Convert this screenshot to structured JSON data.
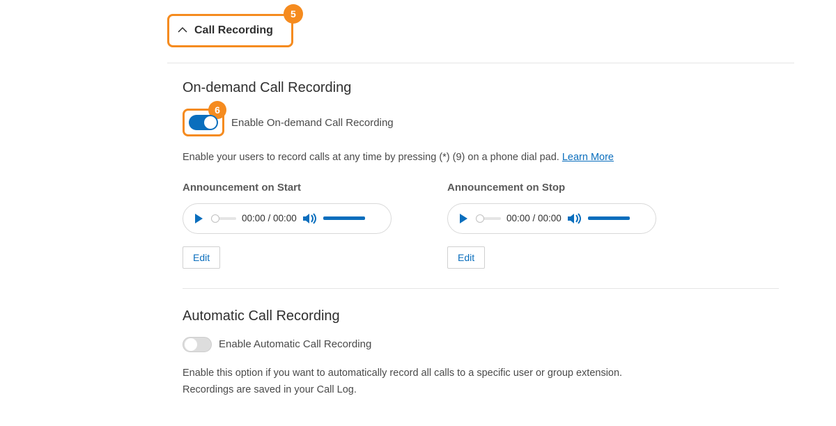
{
  "header": {
    "title": "Call Recording",
    "step_badge": "5"
  },
  "on_demand": {
    "title": "On-demand Call Recording",
    "toggle_step_badge": "6",
    "toggle_enabled": true,
    "toggle_label": "Enable On-demand Call Recording",
    "description": "Enable your users to record calls at any time by pressing (*) (9) on a phone dial pad. ",
    "learn_more": "Learn More",
    "announcements": [
      {
        "label": "Announcement on Start",
        "time": "00:00 / 00:00",
        "edit": "Edit"
      },
      {
        "label": "Announcement on Stop",
        "time": "00:00 / 00:00",
        "edit": "Edit"
      }
    ]
  },
  "automatic": {
    "title": "Automatic Call Recording",
    "toggle_enabled": false,
    "toggle_label": "Enable Automatic Call Recording",
    "description": "Enable this option if you want to automatically record all calls to a specific user or group extension. Recordings are saved in your Call Log."
  }
}
